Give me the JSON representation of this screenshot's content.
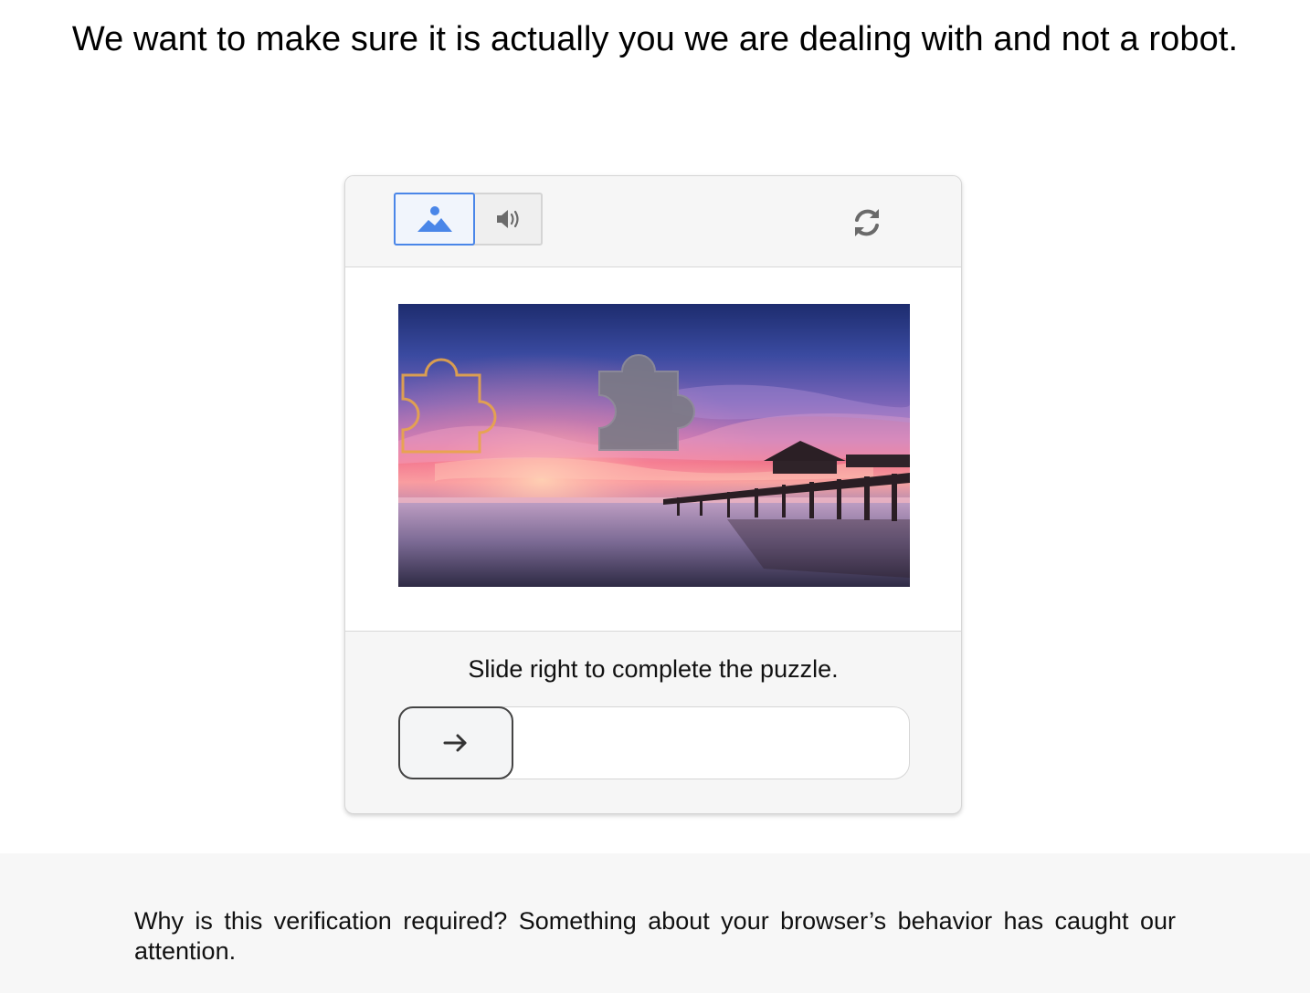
{
  "headline": "We want to make sure it is actually you we are dealing with and not a robot.",
  "captcha": {
    "modes": {
      "image_icon": "image-mountain-icon",
      "audio_icon": "speaker-icon",
      "selected": "image"
    },
    "refresh_icon": "refresh-icon",
    "puzzle_image": {
      "scene": "sunset-pier-over-water",
      "target_piece_icon": "puzzle-piece-outline-icon",
      "moving_piece_icon": "puzzle-piece-icon"
    },
    "instruction": "Slide right to complete the puzzle.",
    "slider": {
      "handle_icon": "arrow-right-icon",
      "progress": 0
    }
  },
  "footer": {
    "text": "Why is this verification required? Something about your browser’s behavior has caught our attention."
  },
  "colors": {
    "accent": "#4a86e8",
    "panel_bg": "#f6f6f6",
    "footer_bg": "#f7f7f7",
    "target_outline": "#e8a548"
  }
}
